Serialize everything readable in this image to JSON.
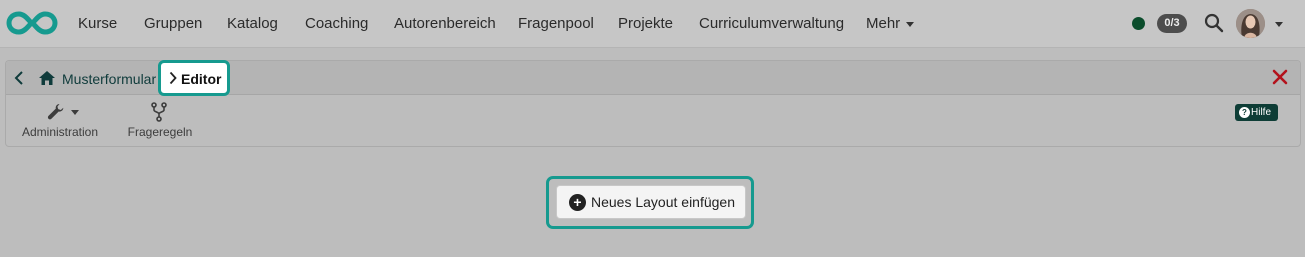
{
  "nav": {
    "items": [
      "Kurse",
      "Gruppen",
      "Katalog",
      "Coaching",
      "Autorenbereich",
      "Fragenpool",
      "Projekte",
      "Curriculumverwaltung",
      "Mehr"
    ],
    "counter": "0/3",
    "status_color": "#0b4d2c",
    "brand_color": "#169a8f"
  },
  "breadcrumb": {
    "parent": "Musterformular",
    "current": "Editor"
  },
  "toolbar": {
    "administration_label": "Administration",
    "frageregeln_label": "Frageregeln",
    "help_label": "Hilfe"
  },
  "main": {
    "new_layout_label": "Neues Layout einfügen"
  }
}
